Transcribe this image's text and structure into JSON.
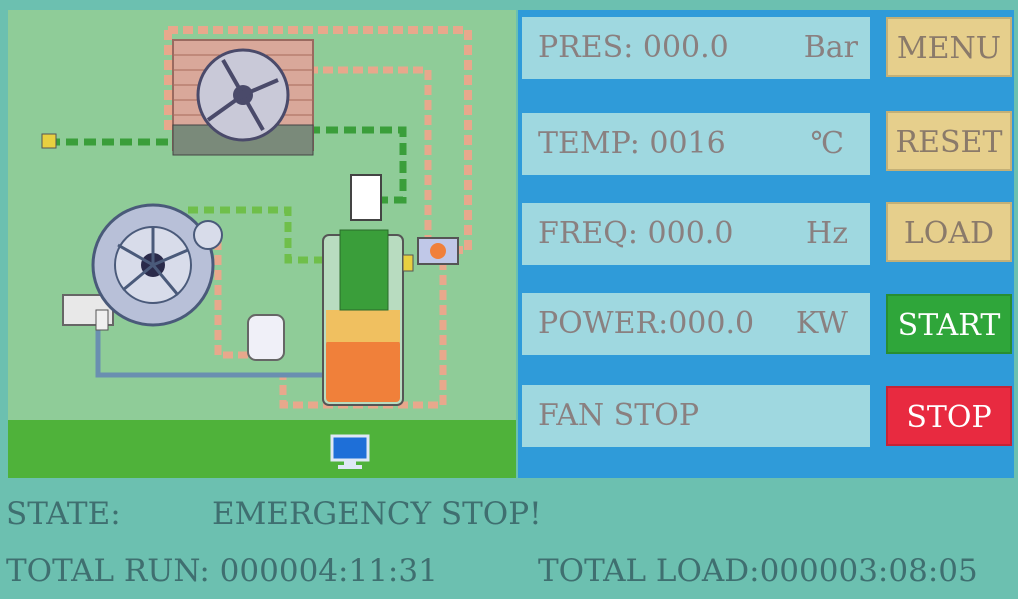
{
  "readouts": {
    "pressure": {
      "text": "PRES: 000.0",
      "unit": "Bar"
    },
    "temperature": {
      "text": "TEMP: 0016",
      "unit": "℃"
    },
    "frequency": {
      "text": "FREQ: 000.0",
      "unit": "Hz"
    },
    "power": {
      "text": "POWER:000.0",
      "unit": "KW"
    },
    "fan": {
      "text": "FAN STOP",
      "unit": ""
    }
  },
  "buttons": {
    "menu": "MENU",
    "reset": "RESET",
    "load": "LOAD",
    "start": "START",
    "stop": "STOP"
  },
  "status": {
    "state_label": "STATE:",
    "state_value": "EMERGENCY STOP!",
    "total_run": "TOTAL RUN: 000004:11:31",
    "total_load": "TOTAL LOAD:000003:08:05"
  },
  "colors": {
    "panel_bg": "#2f9bd9",
    "readout_bg": "#9fd8e0",
    "button_tan": "#e6cf8c",
    "button_start": "#2fa63a",
    "button_stop": "#e82a40",
    "diagram_bg": "#8fcc98"
  },
  "icons": [
    "fan-icon",
    "motor-icon",
    "separator-tank-icon",
    "oil-filter-icon",
    "valve-icon",
    "monitor-icon"
  ]
}
